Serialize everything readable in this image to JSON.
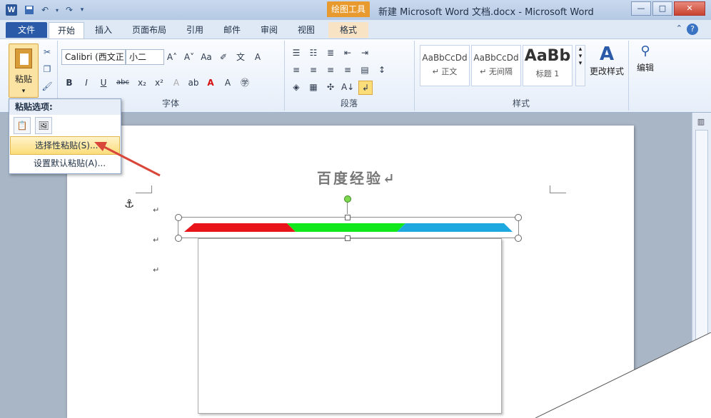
{
  "app": {
    "title": "新建 Microsoft Word 文档.docx - Microsoft Word",
    "context_tab": "绘图工具",
    "icon_letter": "W"
  },
  "window_controls": {
    "minimize": "—",
    "maximize": "□",
    "close": "✕"
  },
  "tabs": [
    {
      "label": "文件"
    },
    {
      "label": "开始"
    },
    {
      "label": "插入"
    },
    {
      "label": "页面布局"
    },
    {
      "label": "引用"
    },
    {
      "label": "邮件"
    },
    {
      "label": "审阅"
    },
    {
      "label": "视图"
    },
    {
      "label": "格式"
    }
  ],
  "ribbon": {
    "clipboard": {
      "paste_label": "粘贴"
    },
    "font": {
      "group_label": "字体",
      "font_name": "Calibri (西文正",
      "font_size": "小二",
      "buttons": {
        "bold": "B",
        "italic": "I",
        "underline": "U",
        "strike": "abc",
        "sub": "x₂",
        "sup": "x²"
      }
    },
    "paragraph": {
      "group_label": "段落"
    },
    "styles": {
      "group_label": "样式",
      "items": [
        {
          "preview": "AaBbCcDd",
          "name": "↵ 正文"
        },
        {
          "preview": "AaBbCcDd",
          "name": "↵ 无间隔"
        },
        {
          "preview": "AaBb",
          "name": "标题 1"
        }
      ],
      "change_styles": "更改样式"
    },
    "editing": {
      "label": "编辑"
    }
  },
  "paste_menu": {
    "header": "粘贴选项:",
    "items": [
      "选择性粘贴(S)...",
      "设置默认粘贴(A)..."
    ]
  },
  "document": {
    "heading": "百度经验↵",
    "para_mark": "↵"
  },
  "colors": {
    "bar_red": "#e8141a",
    "bar_green": "#11e81c",
    "bar_blue": "#1ea8e0",
    "annotation_arrow": "#d9473a"
  }
}
